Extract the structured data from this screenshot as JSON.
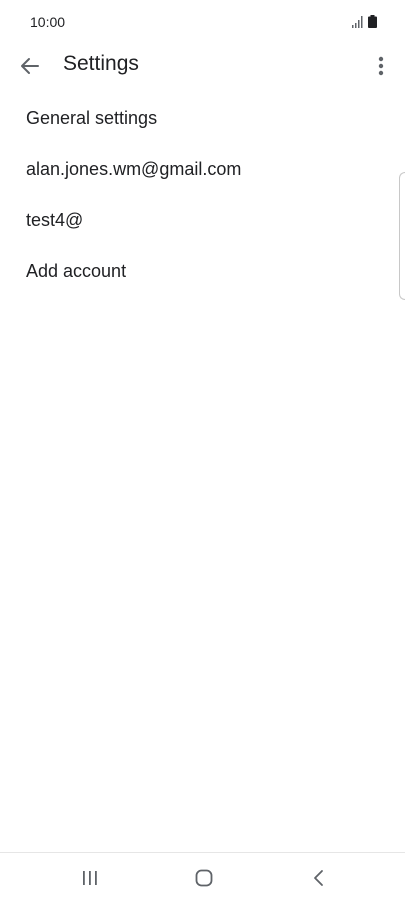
{
  "status_bar": {
    "time": "10:00",
    "icons": [
      "signal-icon",
      "battery-icon"
    ]
  },
  "app_bar": {
    "title": "Settings",
    "back_icon": "arrow-back-icon",
    "menu_icon": "more-vert-icon"
  },
  "settings": {
    "items": [
      {
        "label": "General settings"
      },
      {
        "label": "alan.jones.wm@gmail.com"
      },
      {
        "label": "test4@"
      },
      {
        "label": "Add account"
      }
    ]
  },
  "nav_bar": {
    "icons": [
      "recents-icon",
      "home-icon",
      "back-icon"
    ]
  },
  "colors": {
    "text": "#202124",
    "icon": "#5f6368",
    "background": "#ffffff"
  }
}
